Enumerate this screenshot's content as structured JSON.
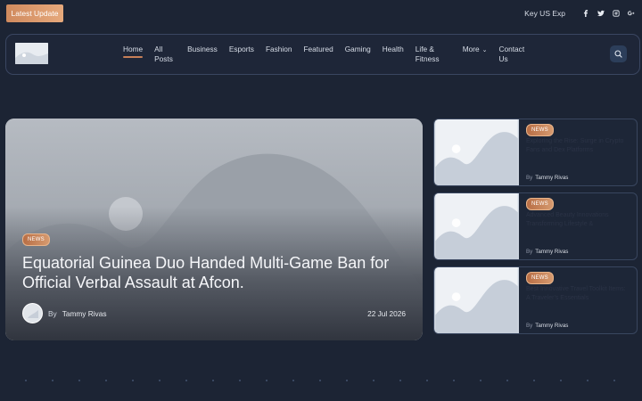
{
  "topbar": {
    "latest_label": "Latest Update",
    "ticker_text": "Key US Exp",
    "social": [
      "facebook-icon",
      "twitter-icon",
      "instagram-icon",
      "google-plus-icon"
    ]
  },
  "nav": {
    "items": [
      {
        "label": "Home",
        "active": true
      },
      {
        "label": "All Posts"
      },
      {
        "label": "Business"
      },
      {
        "label": "Esports"
      },
      {
        "label": "Fashion"
      },
      {
        "label": "Featured"
      },
      {
        "label": "Gaming"
      },
      {
        "label": "Health"
      },
      {
        "label": "Life & Fitness"
      },
      {
        "label": "More"
      },
      {
        "label": "Contact Us"
      }
    ]
  },
  "hero": {
    "badge": "NEWS",
    "title": "Equatorial Guinea Duo Handed Multi-Game Ban for Official Verbal Assault at Afcon.",
    "by": "By",
    "author": "Tammy Rivas",
    "date": "22 Jul 2026"
  },
  "side_cards": [
    {
      "badge": "NEWS",
      "title": "Exploring the Rise: Surge in Crypto Fans and Dex Platforms",
      "by": "By",
      "author": "Tammy Rivas"
    },
    {
      "badge": "NEWS",
      "title": "Advanced Beauty Innovations Transforming Lifestyle &",
      "by": "By",
      "author": "Tammy Rivas"
    },
    {
      "badge": "NEWS",
      "title": "Best Innovative Travel Toolkit Items: A Traveler's Essentials",
      "by": "By",
      "author": "Tammy Rivas"
    }
  ],
  "colors": {
    "accent": "#c67f58",
    "background": "#1c2434"
  }
}
